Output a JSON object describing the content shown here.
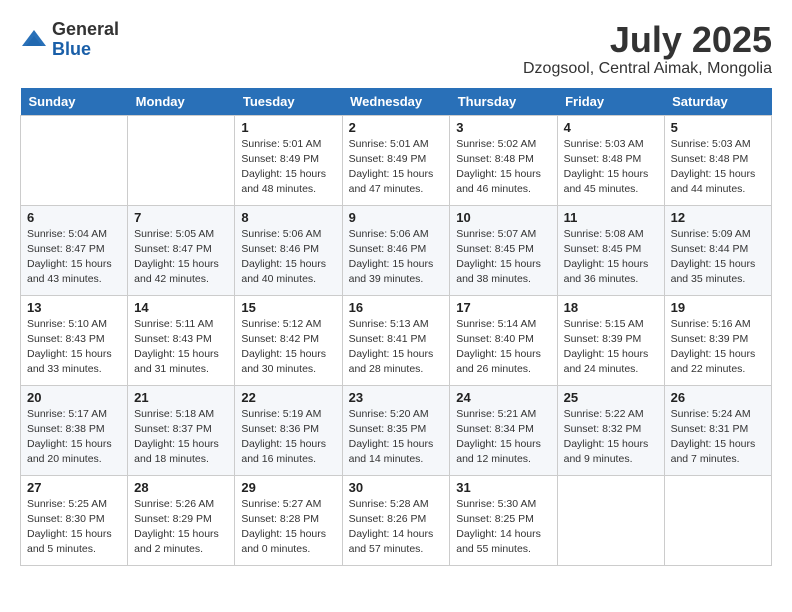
{
  "header": {
    "logo": {
      "general": "General",
      "blue": "Blue"
    },
    "title": "July 2025",
    "location": "Dzogsool, Central Aimak, Mongolia"
  },
  "columns": [
    "Sunday",
    "Monday",
    "Tuesday",
    "Wednesday",
    "Thursday",
    "Friday",
    "Saturday"
  ],
  "weeks": [
    [
      {
        "day": "",
        "info": ""
      },
      {
        "day": "",
        "info": ""
      },
      {
        "day": "1",
        "info": "Sunrise: 5:01 AM\nSunset: 8:49 PM\nDaylight: 15 hours\nand 48 minutes."
      },
      {
        "day": "2",
        "info": "Sunrise: 5:01 AM\nSunset: 8:49 PM\nDaylight: 15 hours\nand 47 minutes."
      },
      {
        "day": "3",
        "info": "Sunrise: 5:02 AM\nSunset: 8:48 PM\nDaylight: 15 hours\nand 46 minutes."
      },
      {
        "day": "4",
        "info": "Sunrise: 5:03 AM\nSunset: 8:48 PM\nDaylight: 15 hours\nand 45 minutes."
      },
      {
        "day": "5",
        "info": "Sunrise: 5:03 AM\nSunset: 8:48 PM\nDaylight: 15 hours\nand 44 minutes."
      }
    ],
    [
      {
        "day": "6",
        "info": "Sunrise: 5:04 AM\nSunset: 8:47 PM\nDaylight: 15 hours\nand 43 minutes."
      },
      {
        "day": "7",
        "info": "Sunrise: 5:05 AM\nSunset: 8:47 PM\nDaylight: 15 hours\nand 42 minutes."
      },
      {
        "day": "8",
        "info": "Sunrise: 5:06 AM\nSunset: 8:46 PM\nDaylight: 15 hours\nand 40 minutes."
      },
      {
        "day": "9",
        "info": "Sunrise: 5:06 AM\nSunset: 8:46 PM\nDaylight: 15 hours\nand 39 minutes."
      },
      {
        "day": "10",
        "info": "Sunrise: 5:07 AM\nSunset: 8:45 PM\nDaylight: 15 hours\nand 38 minutes."
      },
      {
        "day": "11",
        "info": "Sunrise: 5:08 AM\nSunset: 8:45 PM\nDaylight: 15 hours\nand 36 minutes."
      },
      {
        "day": "12",
        "info": "Sunrise: 5:09 AM\nSunset: 8:44 PM\nDaylight: 15 hours\nand 35 minutes."
      }
    ],
    [
      {
        "day": "13",
        "info": "Sunrise: 5:10 AM\nSunset: 8:43 PM\nDaylight: 15 hours\nand 33 minutes."
      },
      {
        "day": "14",
        "info": "Sunrise: 5:11 AM\nSunset: 8:43 PM\nDaylight: 15 hours\nand 31 minutes."
      },
      {
        "day": "15",
        "info": "Sunrise: 5:12 AM\nSunset: 8:42 PM\nDaylight: 15 hours\nand 30 minutes."
      },
      {
        "day": "16",
        "info": "Sunrise: 5:13 AM\nSunset: 8:41 PM\nDaylight: 15 hours\nand 28 minutes."
      },
      {
        "day": "17",
        "info": "Sunrise: 5:14 AM\nSunset: 8:40 PM\nDaylight: 15 hours\nand 26 minutes."
      },
      {
        "day": "18",
        "info": "Sunrise: 5:15 AM\nSunset: 8:39 PM\nDaylight: 15 hours\nand 24 minutes."
      },
      {
        "day": "19",
        "info": "Sunrise: 5:16 AM\nSunset: 8:39 PM\nDaylight: 15 hours\nand 22 minutes."
      }
    ],
    [
      {
        "day": "20",
        "info": "Sunrise: 5:17 AM\nSunset: 8:38 PM\nDaylight: 15 hours\nand 20 minutes."
      },
      {
        "day": "21",
        "info": "Sunrise: 5:18 AM\nSunset: 8:37 PM\nDaylight: 15 hours\nand 18 minutes."
      },
      {
        "day": "22",
        "info": "Sunrise: 5:19 AM\nSunset: 8:36 PM\nDaylight: 15 hours\nand 16 minutes."
      },
      {
        "day": "23",
        "info": "Sunrise: 5:20 AM\nSunset: 8:35 PM\nDaylight: 15 hours\nand 14 minutes."
      },
      {
        "day": "24",
        "info": "Sunrise: 5:21 AM\nSunset: 8:34 PM\nDaylight: 15 hours\nand 12 minutes."
      },
      {
        "day": "25",
        "info": "Sunrise: 5:22 AM\nSunset: 8:32 PM\nDaylight: 15 hours\nand 9 minutes."
      },
      {
        "day": "26",
        "info": "Sunrise: 5:24 AM\nSunset: 8:31 PM\nDaylight: 15 hours\nand 7 minutes."
      }
    ],
    [
      {
        "day": "27",
        "info": "Sunrise: 5:25 AM\nSunset: 8:30 PM\nDaylight: 15 hours\nand 5 minutes."
      },
      {
        "day": "28",
        "info": "Sunrise: 5:26 AM\nSunset: 8:29 PM\nDaylight: 15 hours\nand 2 minutes."
      },
      {
        "day": "29",
        "info": "Sunrise: 5:27 AM\nSunset: 8:28 PM\nDaylight: 15 hours\nand 0 minutes."
      },
      {
        "day": "30",
        "info": "Sunrise: 5:28 AM\nSunset: 8:26 PM\nDaylight: 14 hours\nand 57 minutes."
      },
      {
        "day": "31",
        "info": "Sunrise: 5:30 AM\nSunset: 8:25 PM\nDaylight: 14 hours\nand 55 minutes."
      },
      {
        "day": "",
        "info": ""
      },
      {
        "day": "",
        "info": ""
      }
    ]
  ]
}
